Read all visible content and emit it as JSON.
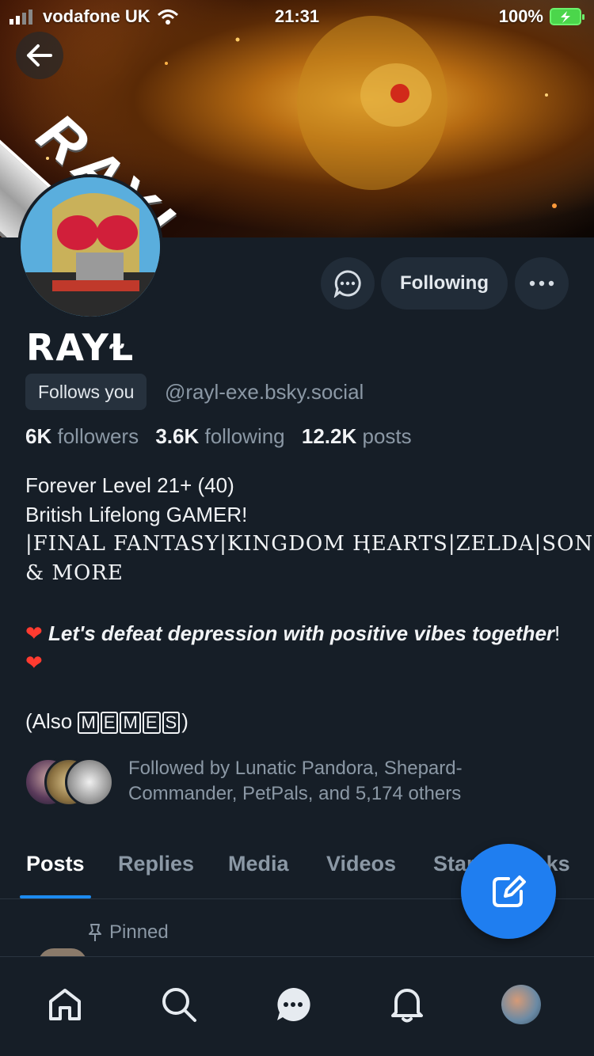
{
  "status_bar": {
    "carrier": "vodafone UK",
    "time": "21:31",
    "battery": "100%"
  },
  "banner": {
    "text": "RAYL"
  },
  "actions": {
    "following_label": "Following"
  },
  "profile": {
    "display_name": "RAYⱢ",
    "follows_you": "Follows you",
    "handle": "@rayl-exe.bsky.social",
    "followers_count": "6K",
    "followers_label": "followers",
    "following_count": "3.6K",
    "following_label": "following",
    "posts_count": "12.2K",
    "posts_label": "posts"
  },
  "bio": {
    "line1": "Forever Level 21+ (40)",
    "line2": "British Lifelong GAMER!",
    "line3": "|FINAL FANTASY|KINGDOM ⱧEARTS|ZELDA|SONIC",
    "line4": "& MORE",
    "vibe": "Let's defeat depression with positive vibes together",
    "vibe_end": "!",
    "also_prefix": "(Also ",
    "memes_letters": [
      "M",
      "E",
      "M",
      "E",
      "S"
    ],
    "also_suffix": ")"
  },
  "followed_by": {
    "text": "Followed by Lunatic Pandora, Shepard-Commander, PetPals, and 5,174 others"
  },
  "tabs": [
    {
      "label": "Posts"
    },
    {
      "label": "Replies"
    },
    {
      "label": "Media"
    },
    {
      "label": "Videos"
    },
    {
      "label": "Starter Packs"
    }
  ],
  "pinned": {
    "label": "Pinned"
  },
  "icons": {
    "back": "arrow-left-icon",
    "message": "chat-bubble-icon",
    "more": "ellipsis-icon",
    "compose": "compose-icon",
    "home": "home-icon",
    "search": "search-icon",
    "chat": "chat-icon",
    "notifications": "bell-icon",
    "pin": "pin-icon"
  },
  "colors": {
    "background": "#161e27",
    "button": "#212c38",
    "accent": "#1f7ef0",
    "muted_text": "#8b98a5"
  }
}
